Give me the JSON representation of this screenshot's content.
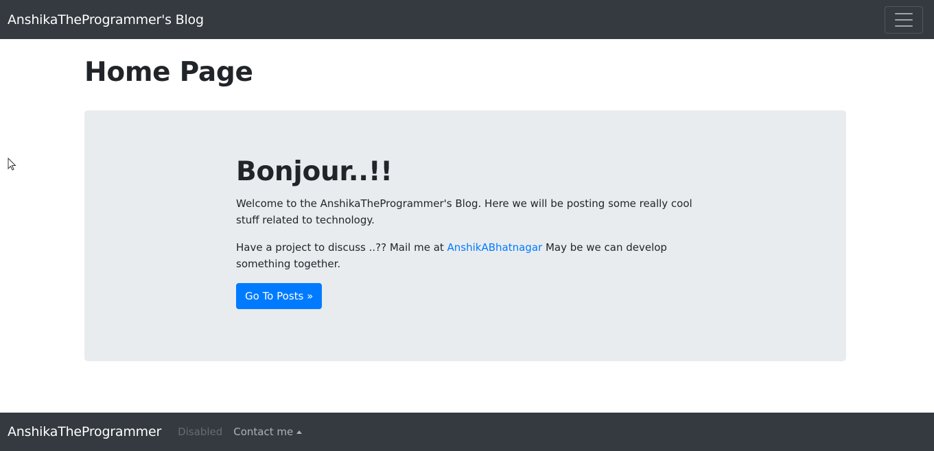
{
  "navbar": {
    "brand": "AnshikaTheProgrammer's Blog",
    "toggler_icon": "hamburger-icon"
  },
  "main": {
    "title": "Home Page",
    "jumbotron": {
      "heading": "Bonjour..!!",
      "intro": "Welcome to the AnshikaTheProgrammer's Blog. Here we will be posting some really cool stuff related to technology.",
      "contact_prefix": "Have a project to discuss ..?? Mail me at ",
      "contact_link": "AnshikABhatnagar",
      "contact_suffix": " May be we can develop something together.",
      "button_label": "Go To Posts »"
    }
  },
  "footer": {
    "brand": "AnshikaTheProgrammer",
    "disabled_label": "Disabled",
    "contact_label": "Contact me"
  },
  "colors": {
    "navbar_bg": "#343a40",
    "jumbotron_bg": "#e9ecef",
    "primary": "#007bff"
  }
}
